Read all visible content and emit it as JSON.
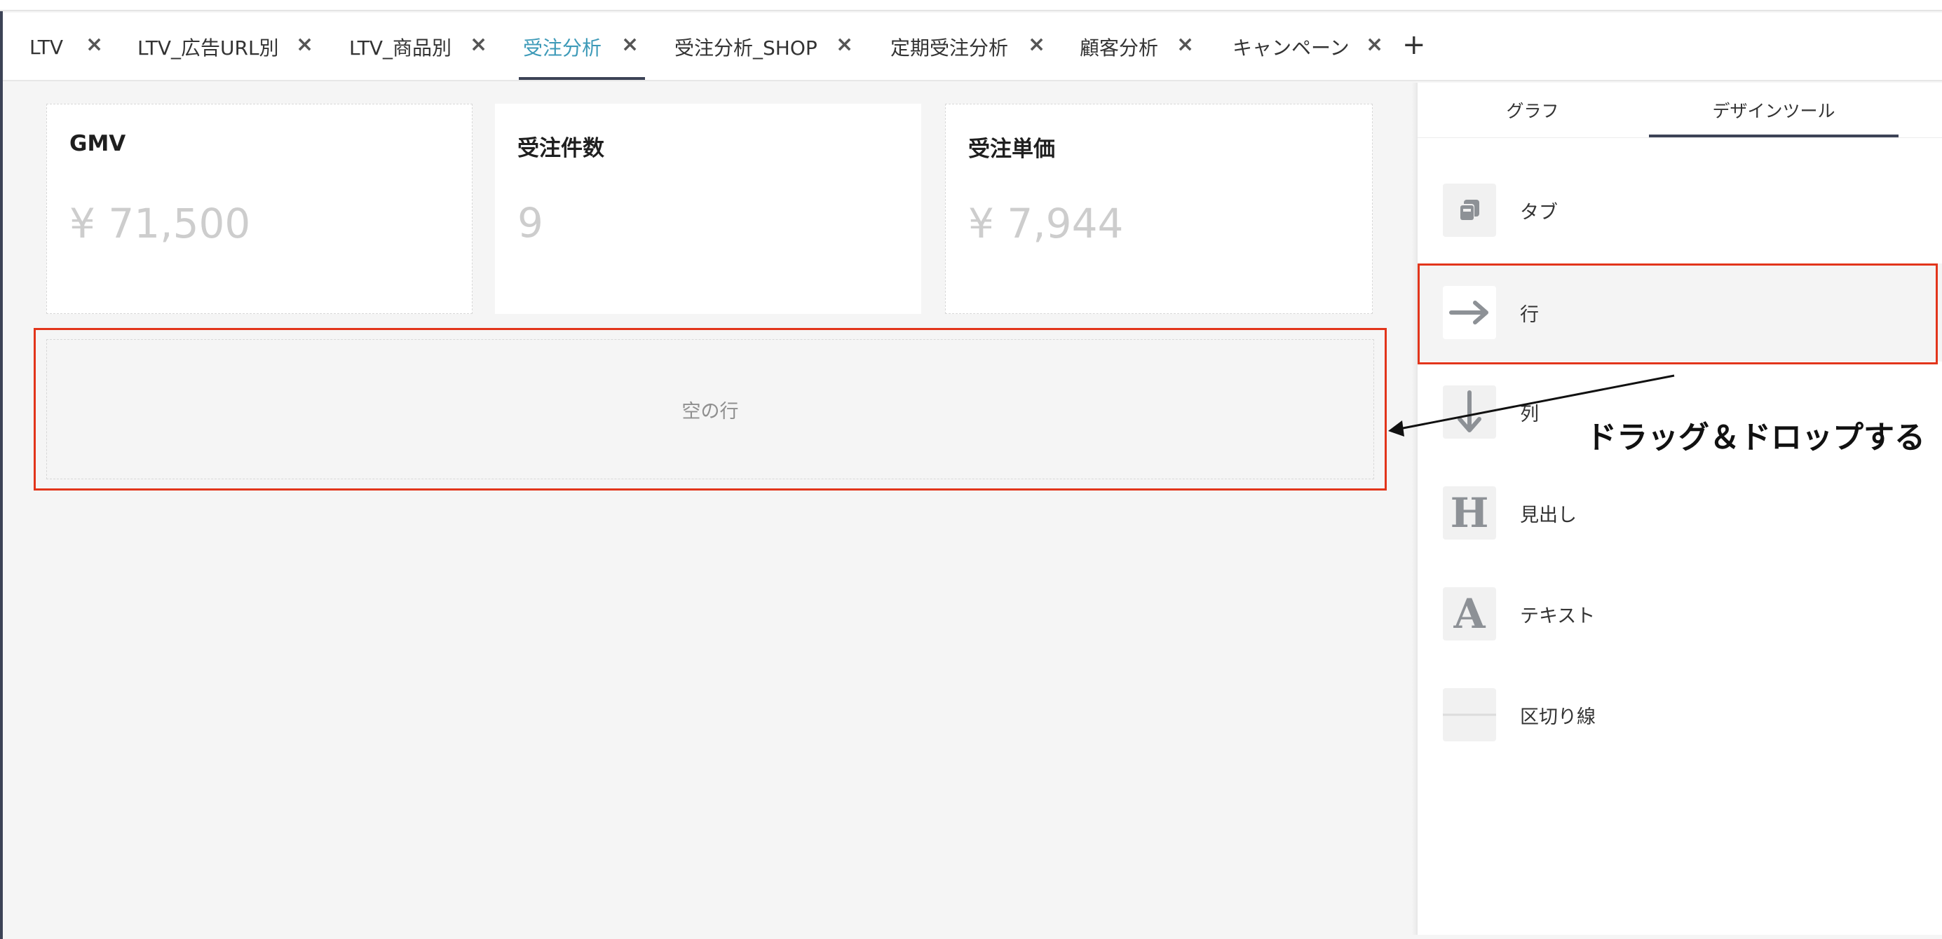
{
  "tabs": [
    {
      "label": "LTV",
      "active": false
    },
    {
      "label": "LTV_広告URL別",
      "active": false
    },
    {
      "label": "LTV_商品別",
      "active": false
    },
    {
      "label": "受注分析",
      "active": true
    },
    {
      "label": "受注分析_SHOP",
      "active": false
    },
    {
      "label": "定期受注分析",
      "active": false
    },
    {
      "label": "顧客分析",
      "active": false
    },
    {
      "label": "キャンペーン",
      "active": false
    }
  ],
  "tab_close_glyph": "×",
  "tab_add_glyph": "+",
  "metrics": [
    {
      "title": "GMV",
      "value": "¥ 71,500"
    },
    {
      "title": "受注件数",
      "value": "9"
    },
    {
      "title": "受注単価",
      "value": "¥ 7,944"
    }
  ],
  "empty_row_label": "空の行",
  "panel": {
    "tabs": [
      "グラフ",
      "デザインツール"
    ],
    "active_tab": "デザインツール",
    "tools": [
      {
        "label": "タブ",
        "icon": "tab-icon"
      },
      {
        "label": "行",
        "icon": "arrow-right-icon",
        "selected": true
      },
      {
        "label": "列",
        "icon": "arrow-down-icon"
      },
      {
        "label": "見出し",
        "icon": "heading-icon"
      },
      {
        "label": "テキスト",
        "icon": "text-icon"
      },
      {
        "label": "区切り線",
        "icon": "divider-icon"
      }
    ]
  },
  "annotation": {
    "text": "ドラッグ＆ドロップする",
    "color": "#e2351b"
  },
  "colors": {
    "accent_tab": "#3d9ab8",
    "underline": "#3c4356",
    "highlight": "#e2351b"
  }
}
